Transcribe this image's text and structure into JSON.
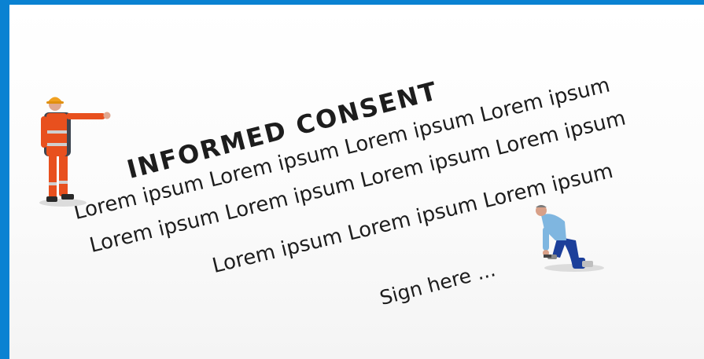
{
  "document": {
    "title": "INFORMED CONSENT",
    "lines": [
      "Lorem ipsum Lorem ipsum Lorem ipsum Lorem ipsum",
      "Lorem ipsum Lorem ipsum Lorem ipsum Lorem ipsum",
      "Lorem ipsum Lorem ipsum Lorem ipsum"
    ],
    "sign_prompt": "Sign here ..."
  },
  "figures": {
    "standing_worker": "miniature-worker-pointing",
    "kneeling_worker": "miniature-worker-kneeling"
  },
  "colors": {
    "frame": "#0a82d2",
    "safety_orange": "#e8501e",
    "hard_hat": "#f0a020",
    "worker_shirt": "#7fb6e0",
    "worker_pants": "#1c3f9a",
    "ink": "#1d1d1d"
  }
}
